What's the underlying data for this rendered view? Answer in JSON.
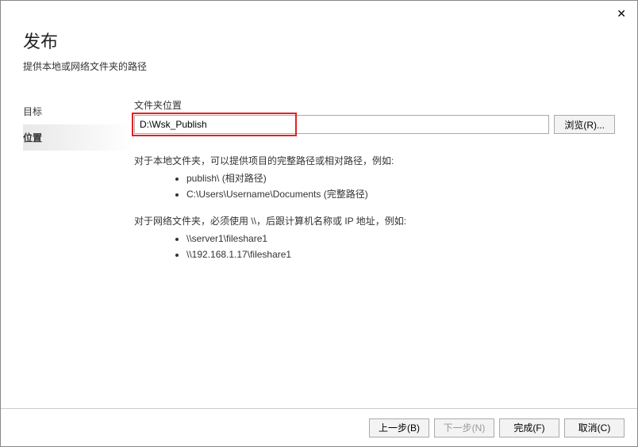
{
  "close_label": "✕",
  "header": {
    "title": "发布",
    "subtitle": "提供本地或网络文件夹的路径"
  },
  "sidebar": {
    "items": [
      {
        "label": "目标"
      },
      {
        "label": "位置"
      }
    ]
  },
  "main": {
    "field_label": "文件夹位置",
    "path_value": "D:\\Wsk_Publish",
    "browse_label": "浏览(R)..."
  },
  "help": {
    "local_intro": "对于本地文件夹，可以提供项目的完整路径或相对路径，例如:",
    "local_examples": [
      "publish\\ (相对路径)",
      "C:\\Users\\Username\\Documents (完整路径)"
    ],
    "network_intro": "对于网络文件夹，必须使用 \\\\，后跟计算机名称或 IP 地址，例如:",
    "network_examples": [
      "\\\\server1\\fileshare1",
      "\\\\192.168.1.17\\fileshare1"
    ]
  },
  "footer": {
    "prev": "上一步(B)",
    "next": "下一步(N)",
    "finish": "完成(F)",
    "cancel": "取消(C)"
  }
}
